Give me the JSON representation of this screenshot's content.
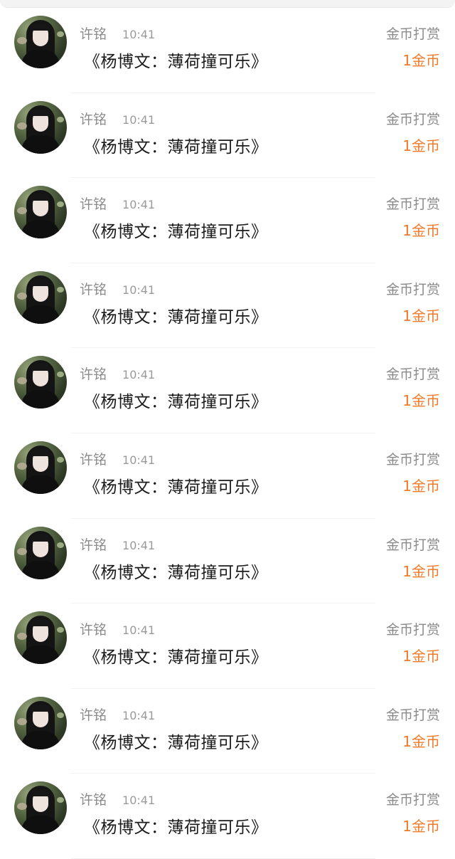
{
  "colors": {
    "accent": "#f07a2a",
    "meta_text": "#8b8b8b",
    "title_text": "#1b1b1b"
  },
  "rows": [
    {
      "user_name": "许铭",
      "time": "10:41",
      "title": "《杨博文：薄荷撞可乐》",
      "gift_label": "金币打赏",
      "gift_amount": "1金币"
    },
    {
      "user_name": "许铭",
      "time": "10:41",
      "title": "《杨博文：薄荷撞可乐》",
      "gift_label": "金币打赏",
      "gift_amount": "1金币"
    },
    {
      "user_name": "许铭",
      "time": "10:41",
      "title": "《杨博文：薄荷撞可乐》",
      "gift_label": "金币打赏",
      "gift_amount": "1金币"
    },
    {
      "user_name": "许铭",
      "time": "10:41",
      "title": "《杨博文：薄荷撞可乐》",
      "gift_label": "金币打赏",
      "gift_amount": "1金币"
    },
    {
      "user_name": "许铭",
      "time": "10:41",
      "title": "《杨博文：薄荷撞可乐》",
      "gift_label": "金币打赏",
      "gift_amount": "1金币"
    },
    {
      "user_name": "许铭",
      "time": "10:41",
      "title": "《杨博文：薄荷撞可乐》",
      "gift_label": "金币打赏",
      "gift_amount": "1金币"
    },
    {
      "user_name": "许铭",
      "time": "10:41",
      "title": "《杨博文：薄荷撞可乐》",
      "gift_label": "金币打赏",
      "gift_amount": "1金币"
    },
    {
      "user_name": "许铭",
      "time": "10:41",
      "title": "《杨博文：薄荷撞可乐》",
      "gift_label": "金币打赏",
      "gift_amount": "1金币"
    },
    {
      "user_name": "许铭",
      "time": "10:41",
      "title": "《杨博文：薄荷撞可乐》",
      "gift_label": "金币打赏",
      "gift_amount": "1金币"
    },
    {
      "user_name": "许铭",
      "time": "10:41",
      "title": "《杨博文：薄荷撞可乐》",
      "gift_label": "金币打赏",
      "gift_amount": "1金币"
    }
  ]
}
